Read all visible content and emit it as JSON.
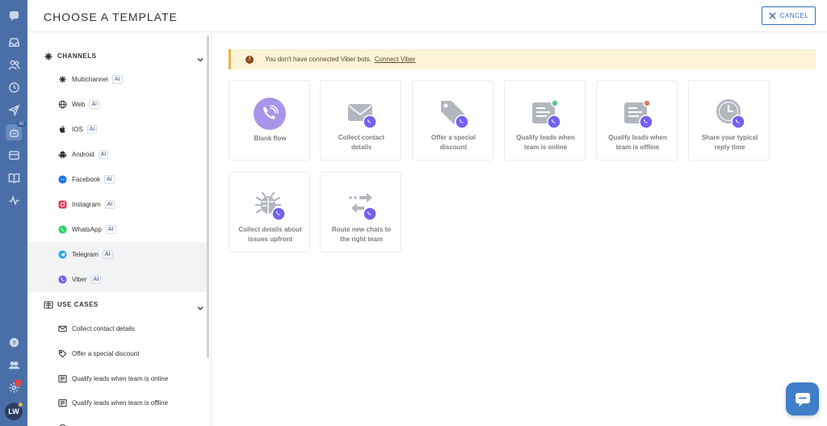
{
  "header": {
    "title": "CHOOSE A TEMPLATE",
    "cancel_label": "CANCEL"
  },
  "sidebar": {
    "channels_label": "CHANNELS",
    "channels": [
      {
        "label": "Multichannel",
        "icon": "multichannel-icon",
        "ai": "AI"
      },
      {
        "label": "Web",
        "icon": "globe-icon",
        "ai": "AI"
      },
      {
        "label": "IOS",
        "icon": "apple-icon",
        "ai": "AI"
      },
      {
        "label": "Android",
        "icon": "android-icon",
        "ai": "AI"
      },
      {
        "label": "Facebook",
        "icon": "messenger-icon",
        "ai": "AI"
      },
      {
        "label": "Instagram",
        "icon": "instagram-icon",
        "ai": "AI"
      },
      {
        "label": "WhatsApp",
        "icon": "whatsapp-icon",
        "ai": "AI"
      },
      {
        "label": "Telegram",
        "icon": "telegram-icon",
        "ai": "AI"
      },
      {
        "label": "Viber",
        "icon": "viber-icon",
        "ai": "AI"
      }
    ],
    "use_cases_label": "USE CASES",
    "use_cases": [
      {
        "label": "Collect contact details",
        "icon": "envelope-icon"
      },
      {
        "label": "Offer a special discount",
        "icon": "tag-icon"
      },
      {
        "label": "Qualify leads when team is online",
        "icon": "form-icon"
      },
      {
        "label": "Qualify leads when team is offline",
        "icon": "form-icon"
      }
    ]
  },
  "alert": {
    "text": "You don't have connected Viber bots.",
    "link": "Connect Viber"
  },
  "templates": [
    {
      "l1": "Blank flow",
      "l2": ""
    },
    {
      "l1": "Collect contact",
      "l2": "details"
    },
    {
      "l1": "Offer a special",
      "l2": "discount"
    },
    {
      "l1": "Qualify leads when",
      "l2": "team is online"
    },
    {
      "l1": "Qualify leads when",
      "l2": "team is offline"
    },
    {
      "l1": "Share your typical",
      "l2": "reply time"
    },
    {
      "l1": "Collect details about",
      "l2": "issues upfront"
    },
    {
      "l1": "Route new chats to",
      "l2": "the right team"
    }
  ],
  "rail": {
    "ai_badge": "AI",
    "avatar_initials": "LW"
  },
  "colors": {
    "rail": "#4a6fa8",
    "accent": "#3a6cc4",
    "viber": "#7360f2",
    "alert_bg": "#fdf3d8"
  }
}
